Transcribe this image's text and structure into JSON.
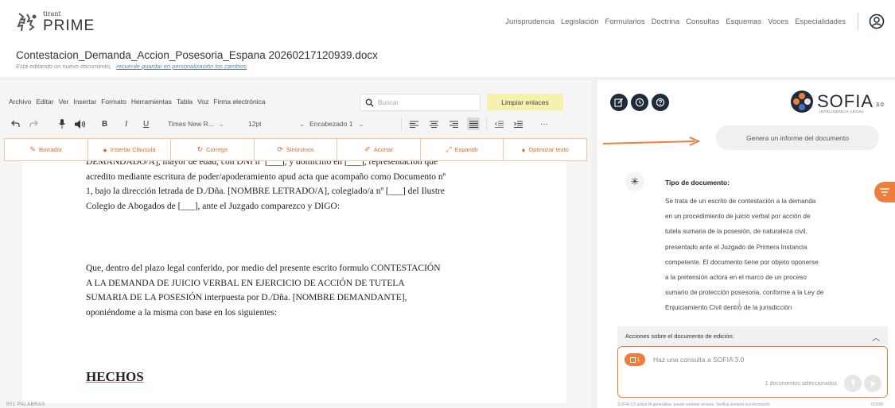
{
  "brand": {
    "small": "tirant",
    "name": "PRIME"
  },
  "nav": [
    "Jurisprudencia",
    "Legislación",
    "Formularios",
    "Doctrina",
    "Consultas",
    "Esquemas",
    "Voces",
    "Especialidades"
  ],
  "document": {
    "title": "Contestacion_Demanda_Accion_Posesoria_Espana 20260217120939.docx",
    "subtitle": "Está editando un nuevo documento,",
    "subtitle_link": "recuerde guardar en personalización los cambios"
  },
  "menubar": [
    "Archivo",
    "Editar",
    "Ver",
    "Insertar",
    "Formato",
    "Herramientas",
    "Tabla",
    "Voz",
    "Firma electrónica"
  ],
  "search": {
    "placeholder": "Buscar"
  },
  "clear_links_label": "Limpiar enlaces",
  "toolbar": {
    "font": "Times New R...",
    "size": "12pt",
    "heading": "Encabezado 1",
    "more": "···"
  },
  "actions": [
    {
      "icon": "✎",
      "label": "Borrador"
    },
    {
      "icon": "●",
      "label": "Insertar Cláusula"
    },
    {
      "icon": "↻",
      "label": "Corregir"
    },
    {
      "icon": "⟳",
      "label": "Sinónimos"
    },
    {
      "icon": "✐",
      "label": "Acortar"
    },
    {
      "icon": "⤢",
      "label": "Expandir"
    },
    {
      "icon": "♦",
      "label": "Optimizar texto"
    }
  ],
  "editor": {
    "lines_p1": [
      "DEMANDADO/A], mayor de edad, con DNI nº [___], y domicilio en [___], representación que",
      "acredito mediante escritura de poder/apoderamiento apud acta que acompaño como Documento nº",
      "1, bajo la dirección letrada de D./Dña. [NOMBRE LETRADO/A], colegiado/a nº [___] del Ilustre",
      "Colegio de Abogados de [___], ante el Juzgado comparezco y DIGO:"
    ],
    "lines_p2": [
      "Que, dentro del plazo legal conferido, por medio del presente escrito formulo CONTESTACIÓN",
      "A LA DEMANDA DE JUICIO VERBAL EN EJERCICIO DE ACCIÓN DE TUTELA",
      "SUMARIA DE LA POSESIÓN interpuesta por D./Dña. [NOMBRE DEMANDANTE],",
      "oponiéndome a la misma con base en los siguientes:"
    ],
    "heading": "HECHOS",
    "word_count": "501 PALABRAS"
  },
  "sofia": {
    "name": "SOFIA",
    "version": "3.0",
    "tagline": "INTELIGENCIA LEGAL",
    "suggestion": "Genera un informe del documento",
    "doc_type_title": "Tipo de documento:",
    "doc_type_lines": [
      "Se trata de un escrito de contestación a la demanda",
      "en un procedimiento de juicio verbal por acción de",
      "tutela sumaria de la posesión, de naturaleza civil,",
      "presentado ante el Juzgado de Primera Instancia",
      "competente. El documento tiene por objeto oponerse",
      "a la pretensión actora en el marco de un proceso",
      "sumario de protección posesoria, conforme a la Ley de",
      "Enjuiciamiento Civil       dentro de la jurisdicción"
    ],
    "actions_title": "Acciones sobre el documento de edición:",
    "chat_chip": "1",
    "chat_placeholder": "Haz una consulta a SOFIA 3.0",
    "selected_docs": "1 documentos seleccionados",
    "footnote": "SOFIA 3.0 utiliza IA generativa, puede cometer errores. Verifica siempre la información.",
    "footnote_right": "0/2000"
  },
  "colors": {
    "accent": "#ef7d3c",
    "dark": "#1f2b3a",
    "highlight": "#f7f1b0"
  }
}
